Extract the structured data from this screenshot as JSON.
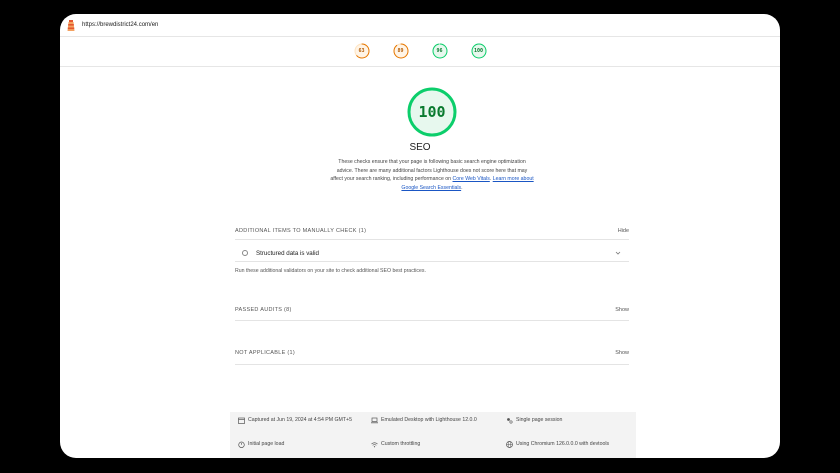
{
  "browser": {
    "url": "https://brewdistrict24.com/en"
  },
  "gauges": [
    {
      "score": "63",
      "color": "#e67700",
      "fraction": 0.63
    },
    {
      "score": "89",
      "color": "#e67700",
      "fraction": 0.89
    },
    {
      "score": "96",
      "color": "#0cce6b",
      "fraction": 0.96
    },
    {
      "score": "100",
      "color": "#0cce6b",
      "fraction": 1.0
    }
  ],
  "category": {
    "score": "100",
    "title": "SEO",
    "description": "These checks ensure that your page is following basic search engine optimization advice. There are many additional factors Lighthouse does not score here that may affect your search ranking, including performance on ",
    "link1": "Core Web Vitals",
    "separator": ". ",
    "link2": "Learn more about Google Search Essentials",
    "end": "."
  },
  "sections": {
    "manual": {
      "title": "ADDITIONAL ITEMS TO MANUALLY CHECK (1)",
      "toggle": "Hide",
      "audit": "Structured data is valid",
      "description": "Run these additional validators on your site to check additional SEO best practices."
    },
    "passed": {
      "title": "PASSED AUDITS (8)",
      "toggle": "Show"
    },
    "not_applicable": {
      "title": "NOT APPLICABLE (1)",
      "toggle": "Show"
    }
  },
  "footer": {
    "captured": "Captured at Jun 19, 2024 at 4:54 PM GMT+5",
    "emulated": "Emulated Desktop with Lighthouse 12.0.0",
    "session": "Single page session",
    "page_load": "Initial page load",
    "throttling": "Custom throttling",
    "chromium": "Using Chromium 126.0.0.0 with devtools"
  }
}
